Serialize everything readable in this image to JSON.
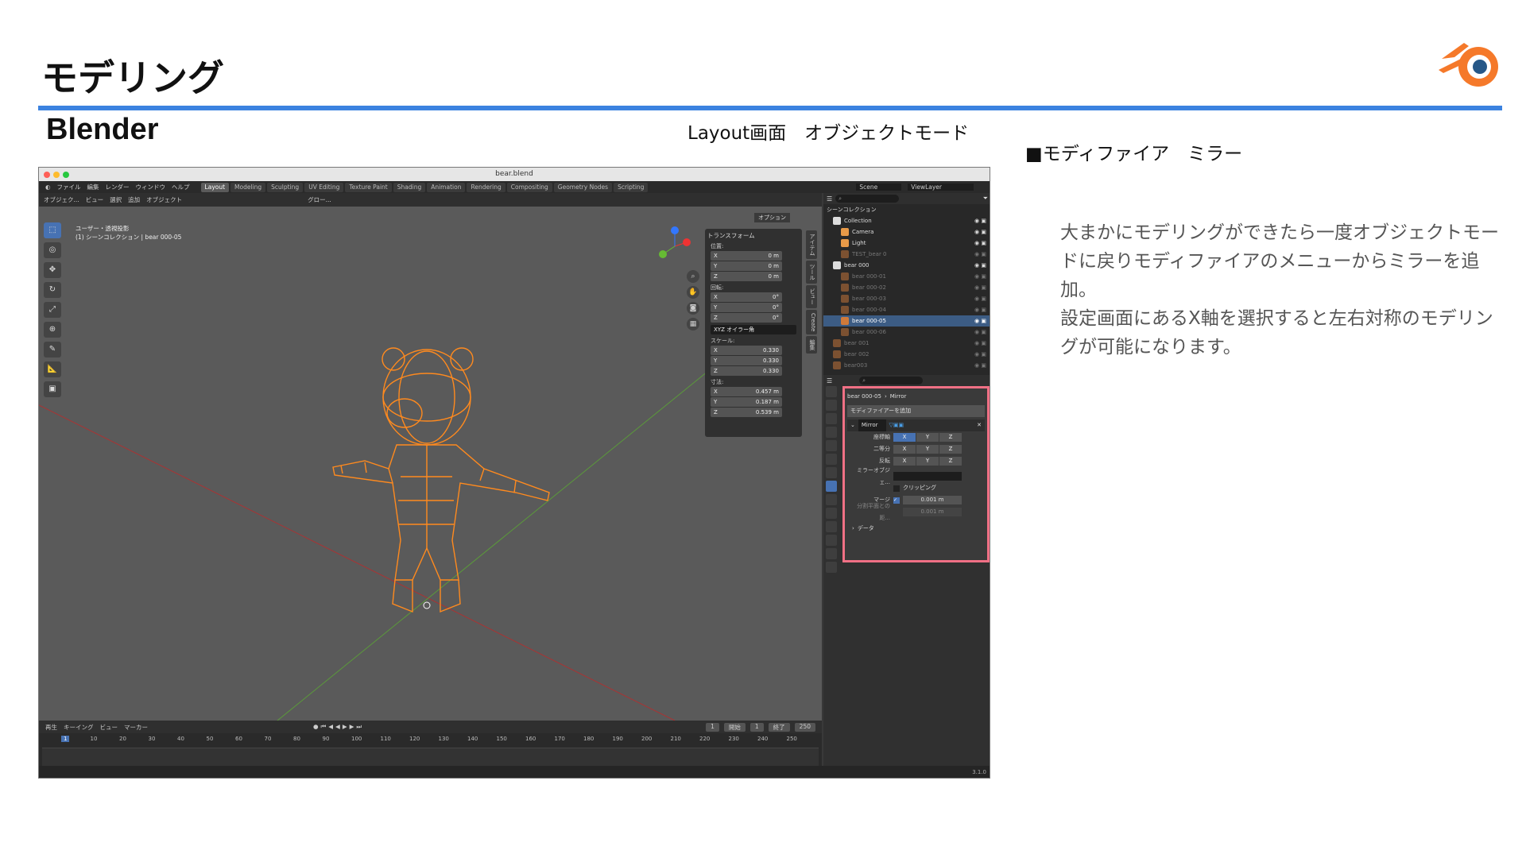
{
  "slide": {
    "title": "モデリング",
    "subtitle": "Blender",
    "mode_label": "Layout画面　オブジェクトモード",
    "modifier_heading": "■モディファイア　ミラー",
    "description": "大まかにモデリングができたら一度オブジェクトモードに戻りモディファイアのメニューからミラーを追加。\n設定画面にあるX軸を選択すると左右対称のモデリングが可能になります。"
  },
  "colors": {
    "accent_rule": "#3b82e0",
    "highlight_box": "#f07085",
    "mesh": "#ff8a1e",
    "blender_orange": "#f5792a",
    "blender_blue": "#265787"
  },
  "window": {
    "title": "bear.blend"
  },
  "menu": [
    "ファイル",
    "編集",
    "レンダー",
    "ウィンドウ",
    "ヘルプ"
  ],
  "workspaces": [
    "Layout",
    "Modeling",
    "Sculpting",
    "UV Editing",
    "Texture Paint",
    "Shading",
    "Animation",
    "Rendering",
    "Compositing",
    "Geometry Nodes",
    "Scripting"
  ],
  "active_workspace": "Layout",
  "scene": "Scene",
  "view_layer": "ViewLayer",
  "viewport_header": [
    "オブジェク...",
    "ビュー",
    "選択",
    "追加",
    "オブジェクト",
    "グロー..."
  ],
  "viewport_info": {
    "line1": "ユーザー・透視投影",
    "line2": "(1) シーンコレクション | bear 000-05"
  },
  "options_label": "オプション",
  "transform": {
    "title": "トランスフォーム",
    "location_label": "位置:",
    "location": [
      {
        "axis": "X",
        "value": "0 m"
      },
      {
        "axis": "Y",
        "value": "0 m"
      },
      {
        "axis": "Z",
        "value": "0 m"
      }
    ],
    "rotation_label": "回転:",
    "rotation": [
      {
        "axis": "X",
        "value": "0°"
      },
      {
        "axis": "Y",
        "value": "0°"
      },
      {
        "axis": "Z",
        "value": "0°"
      }
    ],
    "rotation_mode": "XYZ オイラー角",
    "scale_label": "スケール:",
    "scale": [
      {
        "axis": "X",
        "value": "0.330"
      },
      {
        "axis": "Y",
        "value": "0.330"
      },
      {
        "axis": "Z",
        "value": "0.330"
      }
    ],
    "dimensions_label": "寸法:",
    "dimensions": [
      {
        "axis": "X",
        "value": "0.457 m"
      },
      {
        "axis": "Y",
        "value": "0.187 m"
      },
      {
        "axis": "Z",
        "value": "0.539 m"
      }
    ]
  },
  "side_tabs": [
    "アイテム",
    "ツール",
    "ビュー",
    "Create",
    "編集"
  ],
  "outliner": {
    "root": "シーンコレクション",
    "rows": [
      {
        "name": "Collection",
        "dim": false,
        "hl": false
      },
      {
        "name": "Camera",
        "dim": false,
        "hl": false
      },
      {
        "name": "Light",
        "dim": false,
        "hl": false
      },
      {
        "name": "TEST_bear 0",
        "dim": true,
        "hl": false
      },
      {
        "name": "bear 000",
        "dim": false,
        "hl": false
      },
      {
        "name": "bear 000-01",
        "dim": true,
        "hl": false
      },
      {
        "name": "bear 000-02",
        "dim": true,
        "hl": false
      },
      {
        "name": "bear 000-03",
        "dim": true,
        "hl": false
      },
      {
        "name": "bear 000-04",
        "dim": true,
        "hl": false
      },
      {
        "name": "bear 000-05",
        "dim": false,
        "hl": true
      },
      {
        "name": "bear 000-06",
        "dim": true,
        "hl": false
      },
      {
        "name": "bear 001",
        "dim": true,
        "hl": false
      },
      {
        "name": "bear 002",
        "dim": true,
        "hl": false
      },
      {
        "name": "bear003",
        "dim": true,
        "hl": false
      }
    ]
  },
  "modifier": {
    "object": "bear 000-05",
    "modifier_name": "Mirror",
    "add_button": "モディファイアーを追加",
    "axis_label": "座標軸",
    "bisect_label": "二等分",
    "flip_label": "反転",
    "axes": [
      "X",
      "Y",
      "Z"
    ],
    "axis_active": "X",
    "mirror_object_label": "ミラーオブジェ...",
    "clipping_label": "クリッピング",
    "merge_label": "マージ",
    "merge_value": "0.001 m",
    "bisect_distance_label": "分割平面との距...",
    "bisect_distance_value": "0.001 m",
    "data_label": "データ"
  },
  "timeline": {
    "menu": [
      "再生",
      "キーイング",
      "ビュー",
      "マーカー"
    ],
    "current": "1",
    "start_label": "開始",
    "start": "1",
    "end_label": "終了",
    "end": "250",
    "ticks": [
      "1",
      "10",
      "20",
      "30",
      "40",
      "50",
      "60",
      "70",
      "80",
      "90",
      "100",
      "110",
      "120",
      "130",
      "140",
      "150",
      "160",
      "170",
      "180",
      "190",
      "200",
      "210",
      "220",
      "230",
      "240",
      "250"
    ]
  },
  "version": "3.1.0"
}
